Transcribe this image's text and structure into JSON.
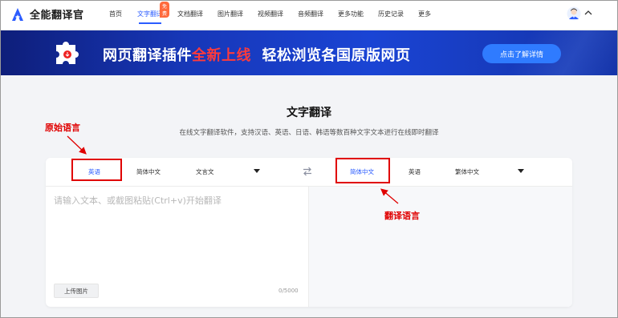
{
  "app": {
    "name": "全能翻译官"
  },
  "nav": {
    "items": [
      "首页",
      "文字翻译",
      "文档翻译",
      "图片翻译",
      "视频翻译",
      "音频翻译",
      "更多功能",
      "历史记录",
      "更多"
    ],
    "active_index": 1,
    "badge": "免费"
  },
  "banner": {
    "text_part1": "网页翻译插件",
    "text_highlight": "全新上线",
    "text_part2": "  轻松浏览各国原版网页",
    "button": "点击了解详情"
  },
  "page": {
    "title": "文字翻译",
    "subtitle": "在线文字翻译软件，支持汉语、英语、日语、韩语等数百种文字文本进行在线即时翻译"
  },
  "source_langs": {
    "selected": "英语",
    "options": [
      "简体中文",
      "文言文"
    ]
  },
  "target_langs": {
    "selected": "简体中文",
    "options": [
      "英语",
      "繁体中文"
    ]
  },
  "input": {
    "placeholder": "请输入文本、或截图粘贴(Ctrl+v)开始翻译",
    "value": ""
  },
  "upload_label": "上传图片",
  "counter": "0/5000",
  "annotations": {
    "source": "原始语言",
    "target": "翻译语言"
  },
  "colors": {
    "accent": "#2b5cff",
    "annotation": "#e00000",
    "banner_highlight": "#ff3b3b"
  }
}
